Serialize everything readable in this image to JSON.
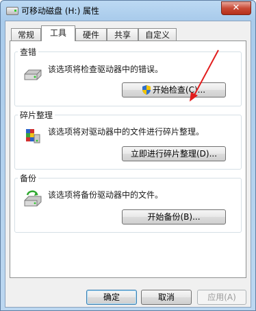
{
  "window": {
    "title": "可移动磁盘 (H:) 属性",
    "close": "✕"
  },
  "tabs": [
    {
      "label": "常规"
    },
    {
      "label": "工具"
    },
    {
      "label": "硬件"
    },
    {
      "label": "共享"
    },
    {
      "label": "自定义"
    }
  ],
  "active_tab": "工具",
  "groups": {
    "check": {
      "title": "查错",
      "description": "该选项将检查驱动器中的错误。",
      "button": "开始检查(C)..."
    },
    "defrag": {
      "title": "碎片整理",
      "description": "该选项将对驱动器中的文件进行碎片整理。",
      "button": "立即进行碎片整理(D)..."
    },
    "backup": {
      "title": "备份",
      "description": "该选项将备份驱动器中的文件。",
      "button": "开始备份(B)..."
    }
  },
  "footer": {
    "ok": "确定",
    "cancel": "取消",
    "apply": "应用(A)"
  },
  "icons": [
    "drive-icon",
    "defrag-icon",
    "backup-icon",
    "uac-shield-icon",
    "red-arrow-annotation"
  ],
  "colors": {
    "accent_arrow": "#e21d1d",
    "title_bar": "#a9cbeb"
  }
}
